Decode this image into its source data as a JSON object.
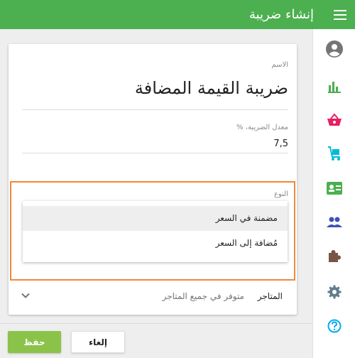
{
  "header": {
    "title": "إنشاء ضريبة",
    "menu_icon": "hamburger-menu-icon"
  },
  "sidebar": {
    "items": [
      {
        "name": "account",
        "icon": "account-circle-icon",
        "color": "#757575"
      },
      {
        "name": "reports",
        "icon": "bar-chart-icon",
        "color": "#4caf50"
      },
      {
        "name": "sales",
        "icon": "shopping-basket-icon",
        "color": "#e91e63"
      },
      {
        "name": "inventory",
        "icon": "cart-icon",
        "color": "#00bcd4"
      },
      {
        "name": "employees",
        "icon": "id-card-icon",
        "color": "#4caf50"
      },
      {
        "name": "customers",
        "icon": "people-icon",
        "color": "#3f51b5"
      },
      {
        "name": "integrations",
        "icon": "puzzle-icon",
        "color": "#795548"
      },
      {
        "name": "settings",
        "icon": "gear-icon",
        "color": "#607d8b"
      },
      {
        "name": "help",
        "icon": "help-icon",
        "color": "#03a9f4"
      }
    ]
  },
  "form": {
    "name_label": "الاسم",
    "name_value": "ضريبة القيمة المضافة",
    "rate_label": "معدل الضريبة، %",
    "rate_value": "7,5",
    "type_label": "النوع",
    "type_options": [
      {
        "label": "مضمنة في السعر",
        "selected": true
      },
      {
        "label": "مُضافة إلى السعر",
        "selected": false
      }
    ],
    "stores_label": "المتاجر",
    "stores_value": "متوفر في جميع المتاجر"
  },
  "buttons": {
    "save": "حفظ",
    "cancel": "إلغاء"
  },
  "colors": {
    "primary": "#4caf50",
    "save_button": "#8bc34a",
    "focus_outline": "#f0883a"
  }
}
